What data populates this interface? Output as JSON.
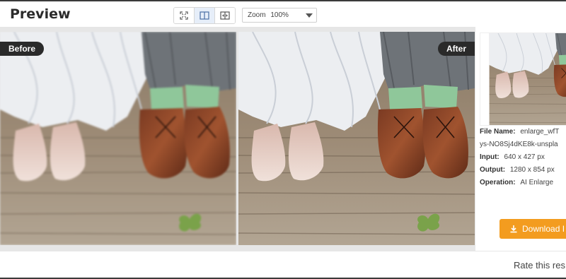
{
  "header": {
    "title": "Preview",
    "zoom_label": "Zoom",
    "zoom_value": "100%"
  },
  "view_modes": [
    {
      "icon": "fit-screen-icon",
      "active": false
    },
    {
      "icon": "side-by-side-icon",
      "active": true
    },
    {
      "icon": "split-compare-icon",
      "active": false
    }
  ],
  "compare": {
    "before_label": "Before",
    "after_label": "After"
  },
  "details": {
    "file_name_label": "File Name:",
    "file_name_value": "enlarge_wfT",
    "file_name_continued": "ys-NO8Sj4dKE8k-unspla",
    "input_label": "Input:",
    "input_value": "640 x 427 px",
    "output_label": "Output:",
    "output_value": "1280 x 854 px",
    "operation_label": "Operation:",
    "operation_value": "AI Enlarge"
  },
  "download_label": "Download I",
  "footer": {
    "rate_text": "Rate this res"
  },
  "colors": {
    "accent": "#f39c1f",
    "badge_bg": "#2a2a2a",
    "active_mode_bg": "#e6eef9"
  }
}
